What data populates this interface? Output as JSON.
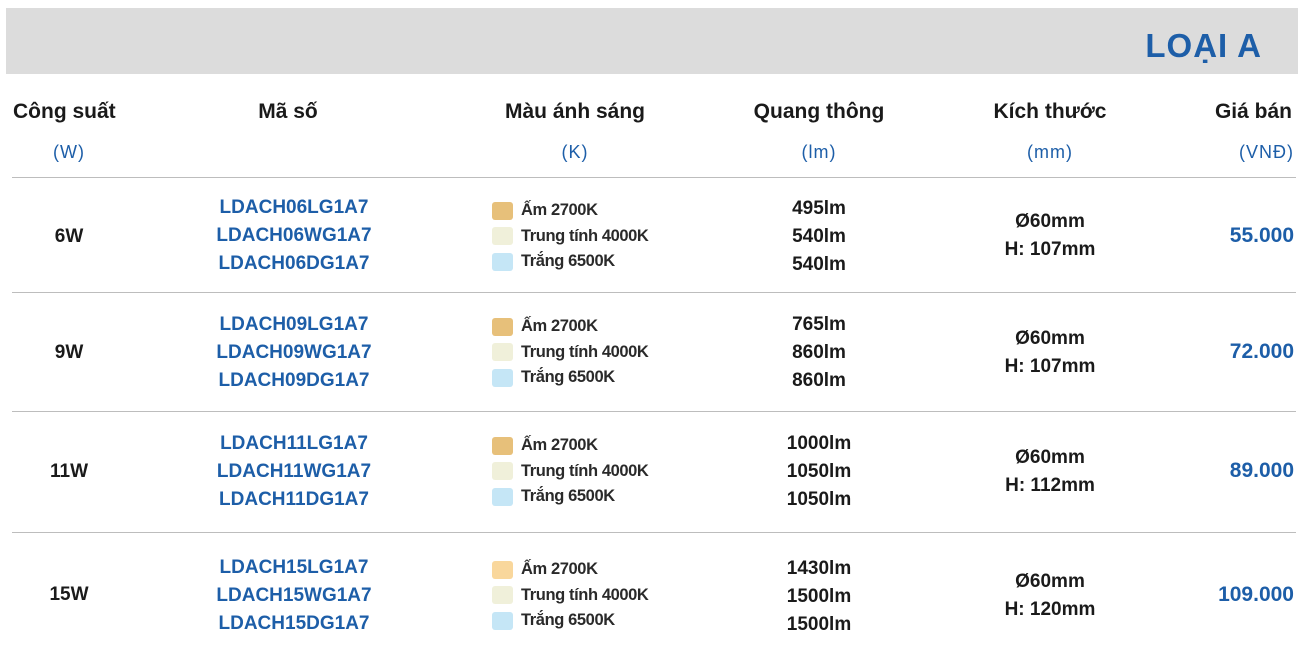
{
  "title": "LOẠI A",
  "headers": [
    {
      "label": "Công suất",
      "unit": "(W)"
    },
    {
      "label": "Mã số",
      "unit": ""
    },
    {
      "label": "Màu ánh sáng",
      "unit": "(K)"
    },
    {
      "label": "Quang thông",
      "unit": "(lm)"
    },
    {
      "label": "Kích thước",
      "unit": "(mm)"
    },
    {
      "label": "Giá bán",
      "unit": "(VNĐ)"
    }
  ],
  "colors": {
    "warm": "#e7c07a",
    "warm_light": "#f9d79c",
    "neutral": "#f0f0da",
    "white": "#c5e6f6",
    "accent": "#1d5ea8"
  },
  "rows": [
    {
      "power": "6W",
      "codes": [
        "LDACH06LG1A7",
        "LDACH06WG1A7",
        "LDACH06DG1A7"
      ],
      "light_colors": [
        "Ấm 2700K",
        "Trung tính 4000K",
        "Trắng 6500K"
      ],
      "lumens": [
        "495lm",
        "540lm",
        "540lm"
      ],
      "size": [
        "Ø60mm",
        "H: 107mm"
      ],
      "price": "55.000"
    },
    {
      "power": "9W",
      "codes": [
        "LDACH09LG1A7",
        "LDACH09WG1A7",
        "LDACH09DG1A7"
      ],
      "light_colors": [
        "Ấm 2700K",
        "Trung tính 4000K",
        "Trắng 6500K"
      ],
      "lumens": [
        "765lm",
        "860lm",
        "860lm"
      ],
      "size": [
        "Ø60mm",
        "H: 107mm"
      ],
      "price": "72.000"
    },
    {
      "power": "11W",
      "codes": [
        "LDACH11LG1A7",
        "LDACH11WG1A7",
        "LDACH11DG1A7"
      ],
      "light_colors": [
        "Ấm 2700K",
        "Trung tính 4000K",
        "Trắng 6500K"
      ],
      "lumens": [
        "1000lm",
        "1050lm",
        "1050lm"
      ],
      "size": [
        "Ø60mm",
        "H: 112mm"
      ],
      "price": "89.000"
    },
    {
      "power": "15W",
      "codes": [
        "LDACH15LG1A7",
        "LDACH15WG1A7",
        "LDACH15DG1A7"
      ],
      "light_colors": [
        "Ấm 2700K",
        "Trung tính 4000K",
        "Trắng 6500K"
      ],
      "lumens": [
        "1430lm",
        "1500lm",
        "1500lm"
      ],
      "size": [
        "Ø60mm",
        "H: 120mm"
      ],
      "price": "109.000"
    }
  ]
}
